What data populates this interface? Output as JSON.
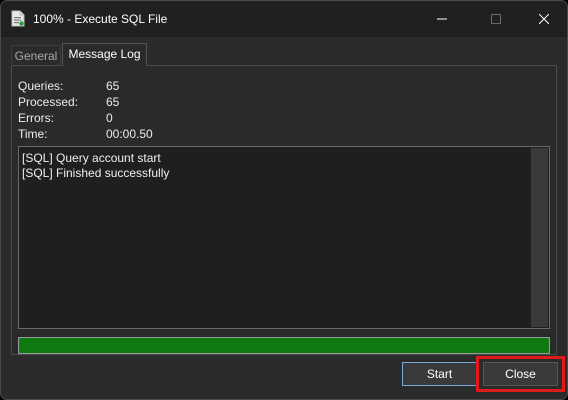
{
  "window": {
    "title": "100% - Execute SQL File"
  },
  "icons": {
    "app": "sql-file-icon",
    "minimize": "minimize-icon",
    "maximize": "maximize-icon",
    "close": "close-icon"
  },
  "tabs": [
    {
      "label": "General",
      "active": false
    },
    {
      "label": "Message Log",
      "active": true
    }
  ],
  "stats": {
    "queries_label": "Queries:",
    "queries_value": "65",
    "processed_label": "Processed:",
    "processed_value": "65",
    "errors_label": "Errors:",
    "errors_value": "0",
    "time_label": "Time:",
    "time_value": "00:00.50"
  },
  "log": {
    "lines": [
      "[SQL] Query account start",
      "[SQL] Finished successfully"
    ]
  },
  "progress": {
    "percent": 100,
    "color": "#0f7a14"
  },
  "buttons": {
    "start_label": "Start",
    "close_label": "Close"
  },
  "colors": {
    "highlight": "#e0191a",
    "focus_border": "#78a7d8"
  }
}
